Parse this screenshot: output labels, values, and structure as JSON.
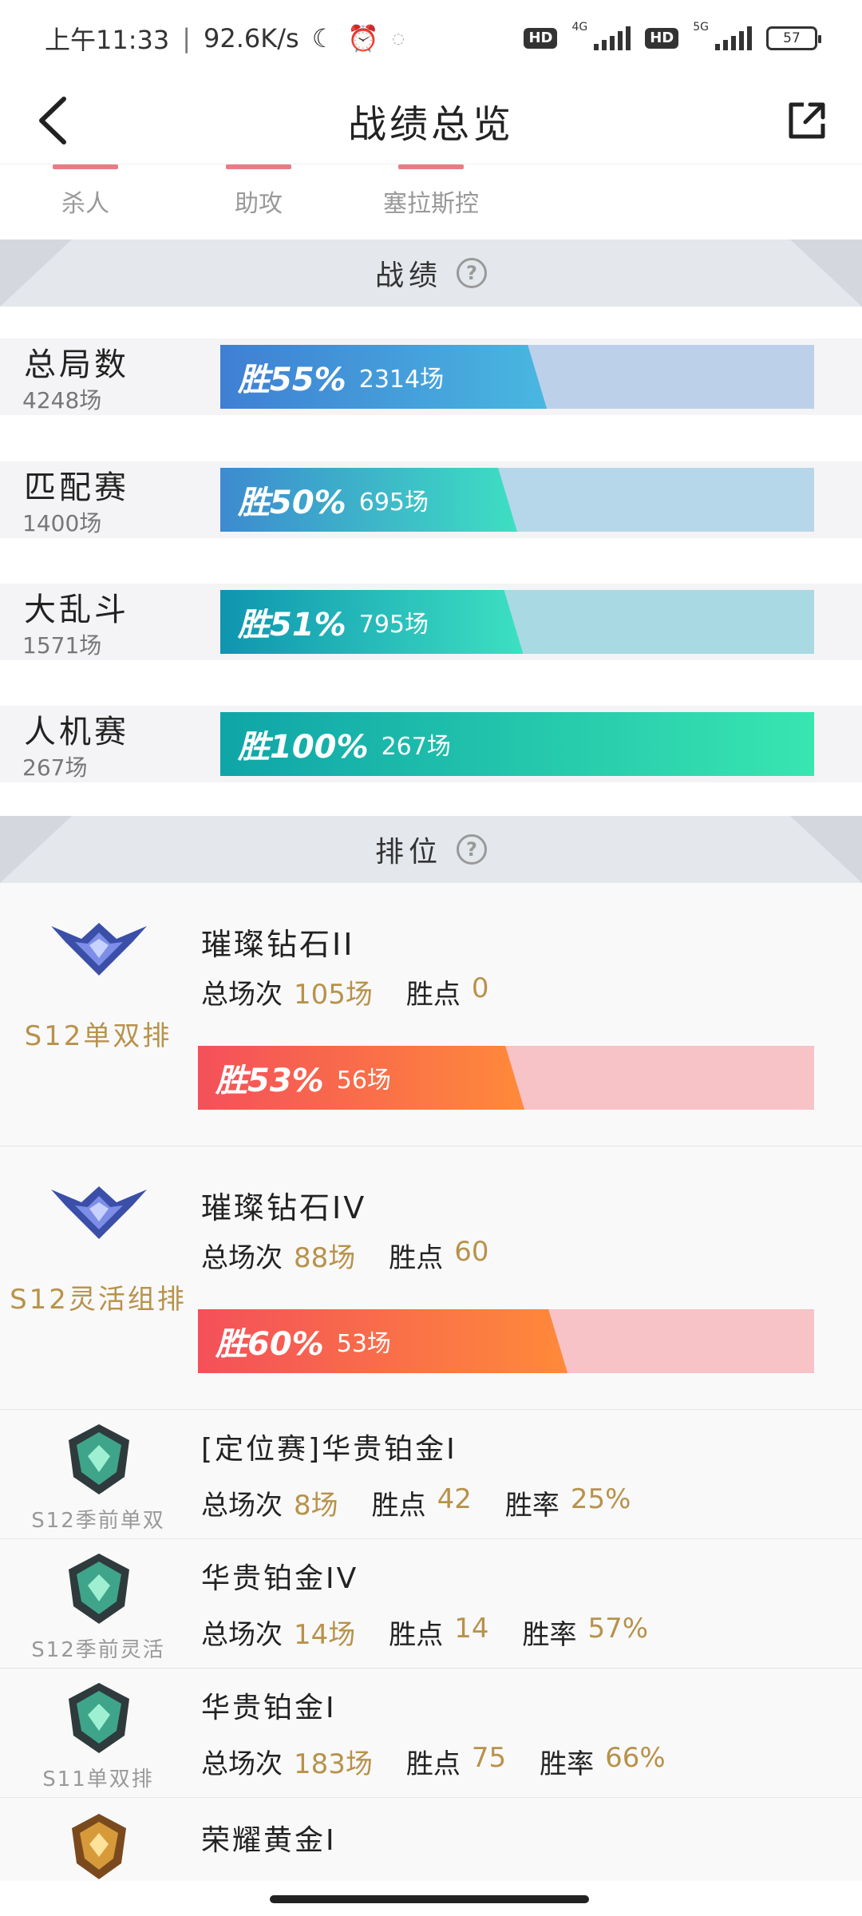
{
  "status": {
    "time": "上午11:33",
    "speed": "92.6K/s",
    "hd1": "HD",
    "net1": "4G",
    "hd2": "HD",
    "net2": "5G",
    "battery": "57"
  },
  "header": {
    "title": "战绩总览"
  },
  "tabs": [
    {
      "label": "杀人"
    },
    {
      "label": "助攻"
    },
    {
      "label": "塞拉斯控"
    }
  ],
  "sections": {
    "record_title": "战绩",
    "rank_title": "排位",
    "help": "?"
  },
  "records": [
    {
      "name": "总局数",
      "total": "4248场",
      "win_label": "胜55%",
      "win_count": "2314场",
      "win_rate": 0.55,
      "color_from": "#3f7fd3",
      "color_to": "#49b7e0",
      "track": "#bcd0ea"
    },
    {
      "name": "匹配赛",
      "total": "1400场",
      "win_label": "胜50%",
      "win_count": "695场",
      "win_rate": 0.5,
      "color_from": "#3d8ad0",
      "color_to": "#3ddfc2",
      "track": "#b6d6ea"
    },
    {
      "name": "大乱斗",
      "total": "1571场",
      "win_label": "胜51%",
      "win_count": "795场",
      "win_rate": 0.51,
      "color_from": "#0f95b0",
      "color_to": "#3de0c2",
      "track": "#a9d9e2"
    },
    {
      "name": "人机赛",
      "total": "267场",
      "win_label": "胜100%",
      "win_count": "267场",
      "win_rate": 1.0,
      "color_from": "#0fa5a8",
      "color_to": "#38e6b0",
      "track": "#a9e5de"
    }
  ],
  "ranked_main": [
    {
      "season": "S12单双排",
      "rank": "璀璨钻石II",
      "games_label": "总场次",
      "games": "105场",
      "points_label": "胜点",
      "points": "0",
      "win_label": "胜53%",
      "win_count": "56场",
      "win_rate": 0.53,
      "emblem": "diamond-emblem-icon"
    },
    {
      "season": "S12灵活组排",
      "rank": "璀璨钻石IV",
      "games_label": "总场次",
      "games": "88场",
      "points_label": "胜点",
      "points": "60",
      "win_label": "胜60%",
      "win_count": "53场",
      "win_rate": 0.6,
      "emblem": "diamond-emblem-icon"
    }
  ],
  "ranked_other": [
    {
      "season": "S12季前单双",
      "rank": "[定位赛]华贵铂金I",
      "games_label": "总场次",
      "games": "8场",
      "points_label": "胜点",
      "points": "42",
      "rate_label": "胜率",
      "rate": "25%",
      "emblem": "platinum-emblem-icon"
    },
    {
      "season": "S12季前灵活",
      "rank": "华贵铂金IV",
      "games_label": "总场次",
      "games": "14场",
      "points_label": "胜点",
      "points": "14",
      "rate_label": "胜率",
      "rate": "57%",
      "emblem": "platinum-emblem-icon"
    },
    {
      "season": "S11单双排",
      "rank": "华贵铂金I",
      "games_label": "总场次",
      "games": "183场",
      "points_label": "胜点",
      "points": "75",
      "rate_label": "胜率",
      "rate": "66%",
      "emblem": "platinum-emblem-icon"
    }
  ],
  "ranked_partial": {
    "rank": "荣耀黄金I",
    "emblem": "gold-emblem-icon"
  },
  "colors": {
    "gold_text": "#b8924a",
    "rank_bar_from": "#f4505a",
    "rank_bar_to": "#ff8a3a",
    "rank_track": "#f7c3c6"
  }
}
